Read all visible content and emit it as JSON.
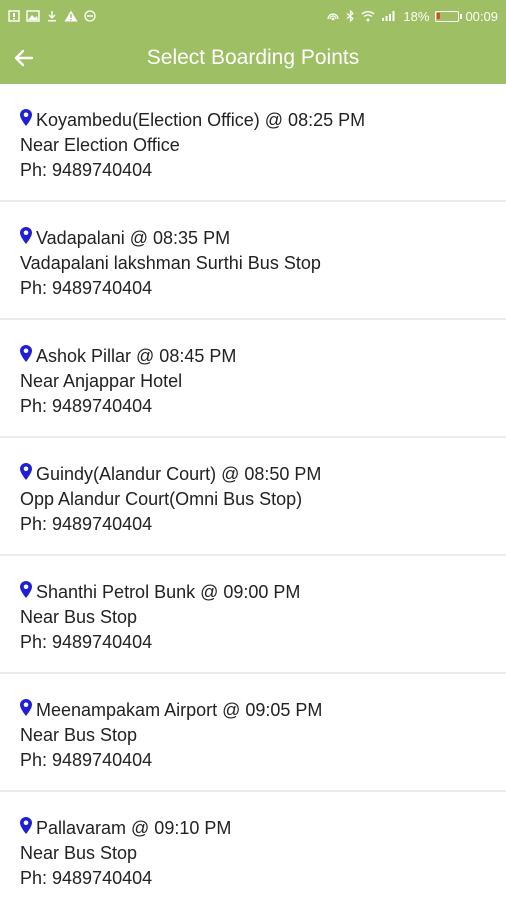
{
  "status_bar": {
    "left_icons": [
      "notification-icon",
      "image-icon",
      "download-icon",
      "warning-icon",
      "minus-circle-icon"
    ],
    "right_icons": [
      "hotspot-icon",
      "bluetooth-icon",
      "wifi-icon",
      "signal-icon"
    ],
    "battery_percent": "18%",
    "battery_level": 0.18,
    "battery_color": "#e5453a",
    "time": "00:09"
  },
  "header": {
    "title": "Select Boarding Points",
    "back_icon": "arrow-left-icon",
    "background_color": "#9ebf63"
  },
  "boarding_points": [
    {
      "title": "Koyambedu(Election Office) @ 08:25 PM",
      "address": "Near Election Office",
      "phone": "Ph: 9489740404"
    },
    {
      "title": "Vadapalani @ 08:35 PM",
      "address": "Vadapalani lakshman Surthi Bus Stop",
      "phone": "Ph: 9489740404"
    },
    {
      "title": "Ashok Pillar @ 08:45 PM",
      "address": "Near Anjappar Hotel",
      "phone": "Ph: 9489740404"
    },
    {
      "title": "Guindy(Alandur Court) @ 08:50 PM",
      "address": "Opp Alandur Court(Omni Bus Stop)",
      "phone": "Ph: 9489740404"
    },
    {
      "title": "Shanthi Petrol Bunk @ 09:00 PM",
      "address": "Near Bus Stop",
      "phone": "Ph: 9489740404"
    },
    {
      "title": "Meenampakam Airport @ 09:05 PM",
      "address": "Near Bus Stop",
      "phone": "Ph: 9489740404"
    },
    {
      "title": "Pallavaram @ 09:10 PM",
      "address": "Near Bus Stop",
      "phone": "Ph: 9489740404"
    }
  ],
  "pin_icon": "location-pin-icon",
  "pin_color": "#1f1fd6"
}
